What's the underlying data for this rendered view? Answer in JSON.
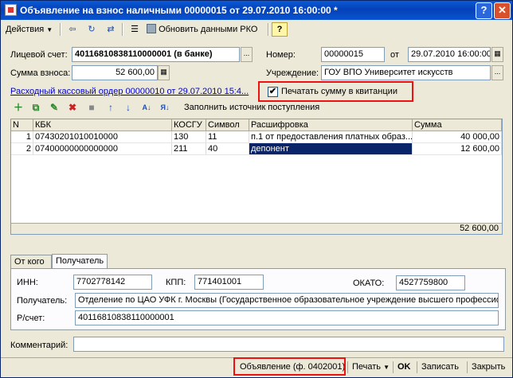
{
  "window": {
    "title": "Объявление на взнос наличными 00000015 от 29.07.2010 16:00:00 *",
    "help_btn": "?",
    "close_btn": "✕"
  },
  "toolbar": {
    "actions_label": "Действия",
    "update_label": "Обновить данными РКО",
    "help_label": "?"
  },
  "form": {
    "account_label": "Лицевой счет:",
    "account_value": "40116810838110000001 (в банке)",
    "amount_label": "Сумма взноса:",
    "amount_value": "52 600,00",
    "number_label": "Номер:",
    "number_value": "00000015",
    "date_label": "от",
    "date_value": "29.07.2010 16:00:00",
    "institution_label": "Учреждение:",
    "institution_value": "ГОУ ВПО Университет искусств",
    "cash_order_link": "Расходный кассовый ордер 00000010 от 29.07.2010 15:4...",
    "print_sum_label": "Печатать сумму в квитанции",
    "print_sum_checked": true,
    "fill_source_label": "Заполнить источник поступления"
  },
  "grid": {
    "columns": [
      "N",
      "КБК",
      "КОСГУ",
      "Символ",
      "Расшифровка",
      "Сумма"
    ],
    "rows": [
      [
        "1",
        "07430201010010000",
        "130",
        "11",
        "п.1 от предоставления платных образ...",
        "40 000,00"
      ],
      [
        "2",
        "07400000000000000",
        "211",
        "40",
        "депонент",
        "12 600,00"
      ]
    ],
    "total": "52 600,00"
  },
  "tabs": {
    "from_label": "От кого",
    "recipient_label": "Получатель"
  },
  "recipient": {
    "inn_label": "ИНН:",
    "inn_value": "7702778142",
    "kpp_label": "КПП:",
    "kpp_value": "771401001",
    "okato_label": "ОКАТО:",
    "okato_value": "4527759800",
    "name_label": "Получатель:",
    "name_value": "Отделение по ЦАО УФК г. Москвы (Государственное образовательное учреждение высшего профессио",
    "account_label": "Р/счет:",
    "account_value": "40116810838110000001"
  },
  "comment": {
    "label": "Комментарий:",
    "value": ""
  },
  "bottom": {
    "announcement_btn": "Объявление (ф. 0402001)",
    "print_btn": "Печать",
    "ok_btn": "OK",
    "save_btn": "Записать",
    "close_btn": "Закрыть"
  },
  "colors": {
    "highlight_frame": "#ee1111",
    "selection": "#0a246a",
    "link": "#0000cc"
  }
}
